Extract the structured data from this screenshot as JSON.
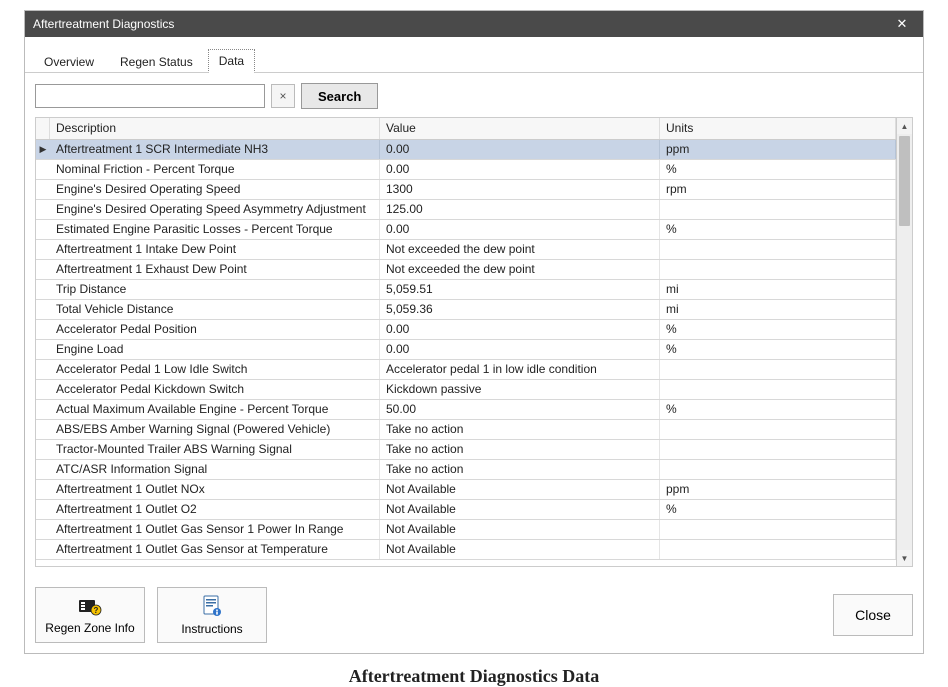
{
  "window": {
    "title": "Aftertreatment Diagnostics"
  },
  "tabs": [
    {
      "label": "Overview",
      "active": false
    },
    {
      "label": "Regen Status",
      "active": false
    },
    {
      "label": "Data",
      "active": true
    }
  ],
  "search": {
    "value": "",
    "placeholder": "",
    "clear_symbol": "×",
    "button_label": "Search"
  },
  "columns": {
    "description": "Description",
    "value": "Value",
    "units": "Units"
  },
  "rows": [
    {
      "desc": "Aftertreatment 1 SCR Intermediate NH3",
      "value": "0.00",
      "units": "ppm",
      "selected": true
    },
    {
      "desc": "Nominal Friction - Percent Torque",
      "value": "0.00",
      "units": "%"
    },
    {
      "desc": "Engine's Desired Operating Speed",
      "value": "1300",
      "units": "rpm"
    },
    {
      "desc": "Engine's Desired Operating Speed Asymmetry Adjustment",
      "value": "125.00",
      "units": ""
    },
    {
      "desc": "Estimated Engine Parasitic Losses - Percent Torque",
      "value": "0.00",
      "units": "%"
    },
    {
      "desc": "Aftertreatment 1 Intake Dew Point",
      "value": "Not exceeded the dew point",
      "units": ""
    },
    {
      "desc": "Aftertreatment 1 Exhaust Dew Point",
      "value": "Not exceeded the dew point",
      "units": ""
    },
    {
      "desc": "Trip Distance",
      "value": "5,059.51",
      "units": "mi"
    },
    {
      "desc": "Total Vehicle Distance",
      "value": "5,059.36",
      "units": "mi"
    },
    {
      "desc": "Accelerator Pedal Position",
      "value": "0.00",
      "units": "%"
    },
    {
      "desc": "Engine Load",
      "value": "0.00",
      "units": "%"
    },
    {
      "desc": "Accelerator Pedal 1 Low Idle Switch",
      "value": "Accelerator pedal 1 in low idle condition",
      "units": ""
    },
    {
      "desc": "Accelerator Pedal Kickdown Switch",
      "value": "Kickdown passive",
      "units": ""
    },
    {
      "desc": "Actual Maximum Available Engine - Percent Torque",
      "value": "50.00",
      "units": "%"
    },
    {
      "desc": "ABS/EBS Amber Warning Signal (Powered Vehicle)",
      "value": "Take no action",
      "units": ""
    },
    {
      "desc": "Tractor-Mounted Trailer ABS Warning Signal",
      "value": "Take no action",
      "units": ""
    },
    {
      "desc": "ATC/ASR Information Signal",
      "value": "Take no action",
      "units": ""
    },
    {
      "desc": "Aftertreatment 1 Outlet NOx",
      "value": "Not Available",
      "units": "ppm"
    },
    {
      "desc": "Aftertreatment 1 Outlet O2",
      "value": "Not Available",
      "units": "%"
    },
    {
      "desc": "Aftertreatment 1 Outlet Gas Sensor 1 Power In Range",
      "value": "Not Available",
      "units": ""
    },
    {
      "desc": "Aftertreatment 1 Outlet Gas Sensor at Temperature",
      "value": "Not Available",
      "units": ""
    }
  ],
  "footer": {
    "regen_zone_label": "Regen Zone Info",
    "instructions_label": "Instructions",
    "close_label": "Close"
  },
  "caption": "Aftertreatment Diagnostics Data"
}
